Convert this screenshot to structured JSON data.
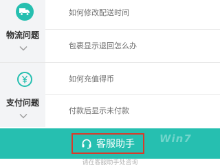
{
  "categories": [
    {
      "icon": "truck-icon",
      "label": "物流问题",
      "questions": [
        "如何修改配送时间",
        "包裹显示退回怎么办"
      ]
    },
    {
      "icon": "yen-coin-icon",
      "label": "支付问题",
      "questions": [
        "如何充值得币",
        "付款后显示未付款"
      ]
    }
  ],
  "customer_service_button": {
    "label": "客服助手",
    "icon": "headset-icon"
  },
  "footnote": "请在客服助手处咨询",
  "watermark": "Win7",
  "colors": {
    "accent": "#26bfb0",
    "highlight_border": "#d93a2a",
    "category_column_bg": "#f3f4f6"
  }
}
